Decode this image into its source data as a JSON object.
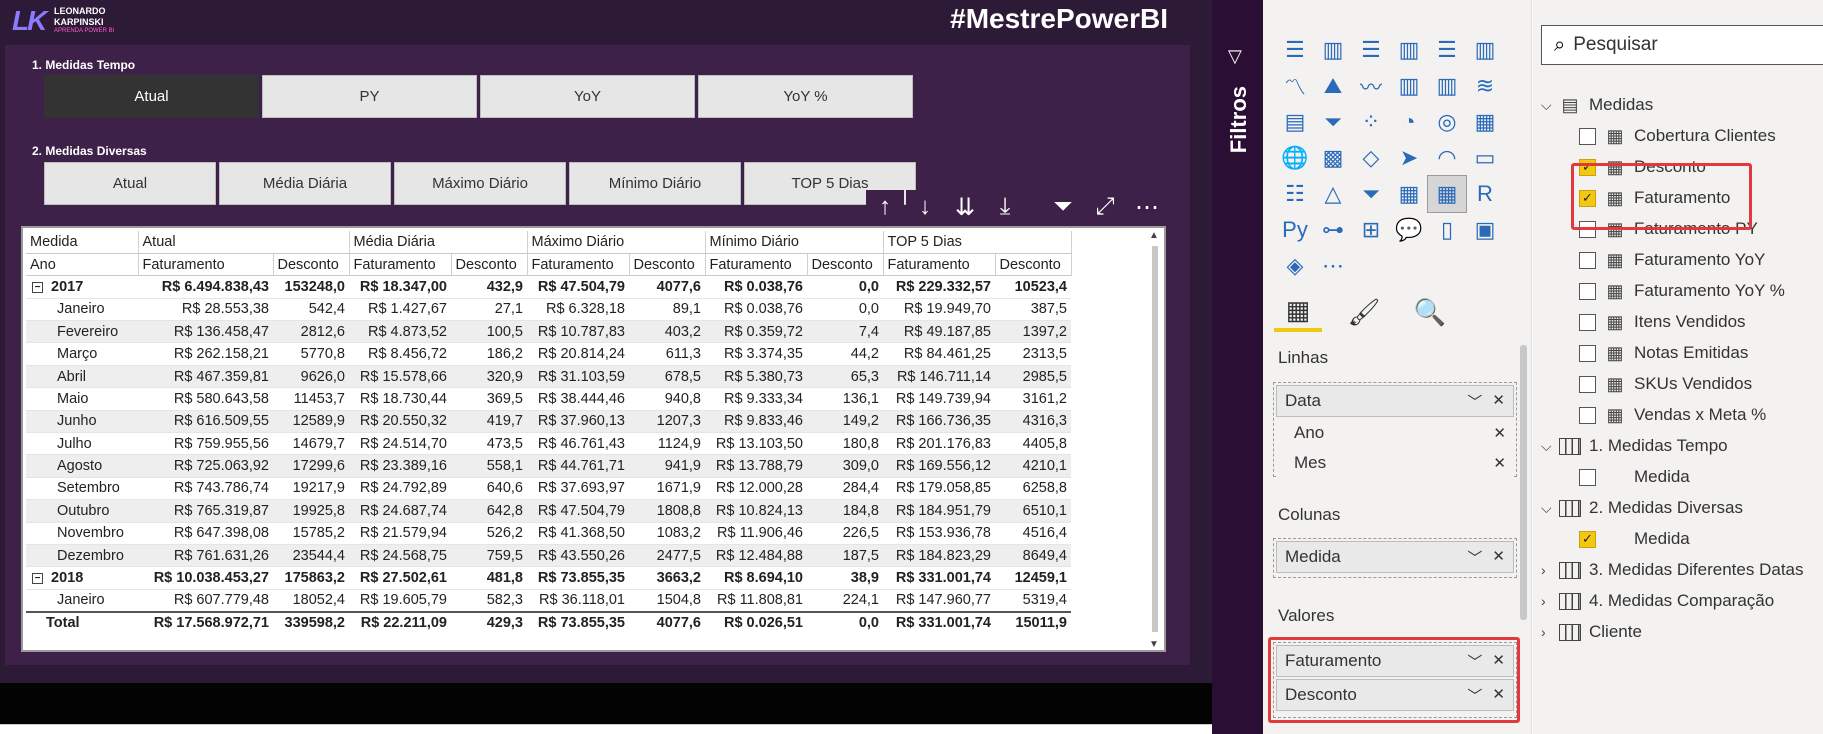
{
  "logo": {
    "line1": "LEONARDO",
    "line2": "KARPINSKI",
    "sub": "APRENDA POWER BI"
  },
  "hashtag": "#MestrePowerBI",
  "slicer1": {
    "label": "1. Medidas Tempo",
    "options": [
      "Atual",
      "PY",
      "YoY",
      "YoY %"
    ],
    "active": "Atual"
  },
  "slicer2": {
    "label": "2. Medidas Diversas",
    "options": [
      "Atual",
      "Média Diária",
      "Máximo Diário",
      "Mínimo Diário",
      "TOP 5 Dias"
    ]
  },
  "matrix": {
    "corner1": "Medida",
    "corner2": "Ano",
    "groups": [
      "Atual",
      "Média Diária",
      "Máximo Diário",
      "Mínimo Diário",
      "TOP 5 Dias"
    ],
    "subcols": [
      "Faturamento",
      "Desconto"
    ],
    "rows": [
      {
        "label": "2017",
        "year": true,
        "values": [
          "R$ 6.494.838,43",
          "153248,0",
          "R$ 18.347,00",
          "432,9",
          "R$ 47.504,79",
          "4077,6",
          "R$ 0.038,76",
          "0,0",
          "R$ 229.332,57",
          "10523,4"
        ]
      },
      {
        "label": "Janeiro",
        "values": [
          "R$ 28.553,38",
          "542,4",
          "R$ 1.427,67",
          "27,1",
          "R$ 6.328,18",
          "89,1",
          "R$ 0.038,76",
          "0,0",
          "R$ 19.949,70",
          "387,5"
        ]
      },
      {
        "label": "Fevereiro",
        "values": [
          "R$ 136.458,47",
          "2812,6",
          "R$ 4.873,52",
          "100,5",
          "R$ 10.787,83",
          "403,2",
          "R$ 0.359,72",
          "7,4",
          "R$ 49.187,85",
          "1397,2"
        ]
      },
      {
        "label": "Março",
        "values": [
          "R$ 262.158,21",
          "5770,8",
          "R$ 8.456,72",
          "186,2",
          "R$ 20.814,24",
          "611,3",
          "R$ 3.374,35",
          "44,2",
          "R$ 84.461,25",
          "2313,5"
        ]
      },
      {
        "label": "Abril",
        "values": [
          "R$ 467.359,81",
          "9626,0",
          "R$ 15.578,66",
          "320,9",
          "R$ 31.103,59",
          "678,5",
          "R$ 5.380,73",
          "65,3",
          "R$ 146.711,14",
          "2985,5"
        ]
      },
      {
        "label": "Maio",
        "values": [
          "R$ 580.643,58",
          "11453,7",
          "R$ 18.730,44",
          "369,5",
          "R$ 38.444,46",
          "940,8",
          "R$ 9.333,34",
          "136,1",
          "R$ 149.739,94",
          "3161,2"
        ]
      },
      {
        "label": "Junho",
        "values": [
          "R$ 616.509,55",
          "12589,9",
          "R$ 20.550,32",
          "419,7",
          "R$ 37.960,13",
          "1207,3",
          "R$ 9.833,46",
          "149,2",
          "R$ 166.736,35",
          "4316,3"
        ]
      },
      {
        "label": "Julho",
        "values": [
          "R$ 759.955,56",
          "14679,7",
          "R$ 24.514,70",
          "473,5",
          "R$ 46.761,43",
          "1124,9",
          "R$ 13.103,50",
          "180,8",
          "R$ 201.176,83",
          "4405,8"
        ]
      },
      {
        "label": "Agosto",
        "values": [
          "R$ 725.063,92",
          "17299,6",
          "R$ 23.389,16",
          "558,1",
          "R$ 44.761,71",
          "941,9",
          "R$ 13.788,79",
          "309,0",
          "R$ 169.556,12",
          "4210,1"
        ]
      },
      {
        "label": "Setembro",
        "values": [
          "R$ 743.786,74",
          "19217,9",
          "R$ 24.792,89",
          "640,6",
          "R$ 37.693,97",
          "1671,9",
          "R$ 12.000,28",
          "284,4",
          "R$ 179.058,85",
          "6258,8"
        ]
      },
      {
        "label": "Outubro",
        "values": [
          "R$ 765.319,87",
          "19925,8",
          "R$ 24.687,74",
          "642,8",
          "R$ 47.504,79",
          "1808,8",
          "R$ 10.824,13",
          "184,8",
          "R$ 184.951,79",
          "6510,1"
        ]
      },
      {
        "label": "Novembro",
        "values": [
          "R$ 647.398,08",
          "15785,2",
          "R$ 21.579,94",
          "526,2",
          "R$ 41.368,50",
          "1083,2",
          "R$ 11.906,46",
          "226,5",
          "R$ 153.936,78",
          "4516,4"
        ]
      },
      {
        "label": "Dezembro",
        "values": [
          "R$ 761.631,26",
          "23544,4",
          "R$ 24.568,75",
          "759,5",
          "R$ 43.550,26",
          "2477,5",
          "R$ 12.484,88",
          "187,5",
          "R$ 184.823,29",
          "8649,4"
        ]
      },
      {
        "label": "2018",
        "year": true,
        "values": [
          "R$ 10.038.453,27",
          "175863,2",
          "R$ 27.502,61",
          "481,8",
          "R$ 73.855,35",
          "3663,2",
          "R$ 8.694,10",
          "38,9",
          "R$ 331.001,74",
          "12459,1"
        ]
      },
      {
        "label": "Janeiro",
        "values": [
          "R$ 607.779,48",
          "18052,4",
          "R$ 19.605,79",
          "582,3",
          "R$ 36.118,01",
          "1504,8",
          "R$ 11.808,81",
          "224,1",
          "R$ 147.960,77",
          "5319,4"
        ]
      }
    ],
    "total": {
      "label": "Total",
      "values": [
        "R$ 17.568.972,71",
        "339598,2",
        "R$ 22.211,09",
        "429,3",
        "R$ 73.855,35",
        "4077,6",
        "R$ 0.026,51",
        "0,0",
        "R$ 331.001,74",
        "15011,9"
      ]
    }
  },
  "filters": {
    "label": "Filtros"
  },
  "viz": {
    "wells": {
      "linhas": {
        "label": "Linhas",
        "field": "Data",
        "subfields": [
          "Ano",
          "Mes"
        ]
      },
      "colunas": {
        "label": "Colunas",
        "field": "Medida"
      },
      "valores": {
        "label": "Valores",
        "fields": [
          "Faturamento",
          "Desconto"
        ]
      }
    }
  },
  "fields": {
    "search_placeholder": "Pesquisar",
    "items": [
      {
        "label": "Medidas",
        "type": "table-measure",
        "level": 0,
        "expanded": true
      },
      {
        "label": "Cobertura Clientes",
        "type": "measure",
        "level": 1,
        "checked": false
      },
      {
        "label": "Desconto",
        "type": "measure",
        "level": 1,
        "checked": true
      },
      {
        "label": "Faturamento",
        "type": "measure",
        "level": 1,
        "checked": true
      },
      {
        "label": "Faturamento PY",
        "type": "measure",
        "level": 1,
        "checked": false
      },
      {
        "label": "Faturamento YoY",
        "type": "measure",
        "level": 1,
        "checked": false
      },
      {
        "label": "Faturamento YoY %",
        "type": "measure",
        "level": 1,
        "checked": false
      },
      {
        "label": "Itens Vendidos",
        "type": "measure",
        "level": 1,
        "checked": false
      },
      {
        "label": "Notas Emitidas",
        "type": "measure",
        "level": 1,
        "checked": false
      },
      {
        "label": "SKUs Vendidos",
        "type": "measure",
        "level": 1,
        "checked": false
      },
      {
        "label": "Vendas x Meta %",
        "type": "measure",
        "level": 1,
        "checked": false
      },
      {
        "label": "1. Medidas Tempo",
        "type": "table",
        "level": 0,
        "expanded": true
      },
      {
        "label": "Medida",
        "type": "column",
        "level": 1,
        "checked": false
      },
      {
        "label": "2. Medidas Diversas",
        "type": "table-checked",
        "level": 0,
        "expanded": true
      },
      {
        "label": "Medida",
        "type": "column",
        "level": 1,
        "checked": true
      },
      {
        "label": "3. Medidas Diferentes Datas",
        "type": "table",
        "level": 0,
        "expanded": false
      },
      {
        "label": "4. Medidas Comparação",
        "type": "table",
        "level": 0,
        "expanded": false
      },
      {
        "label": "Cliente",
        "type": "table",
        "level": 0,
        "expanded": false
      }
    ]
  },
  "colors": {
    "accent": "#f2c811",
    "highlight": "#e0393e",
    "report_bg": "#2d1a36"
  }
}
